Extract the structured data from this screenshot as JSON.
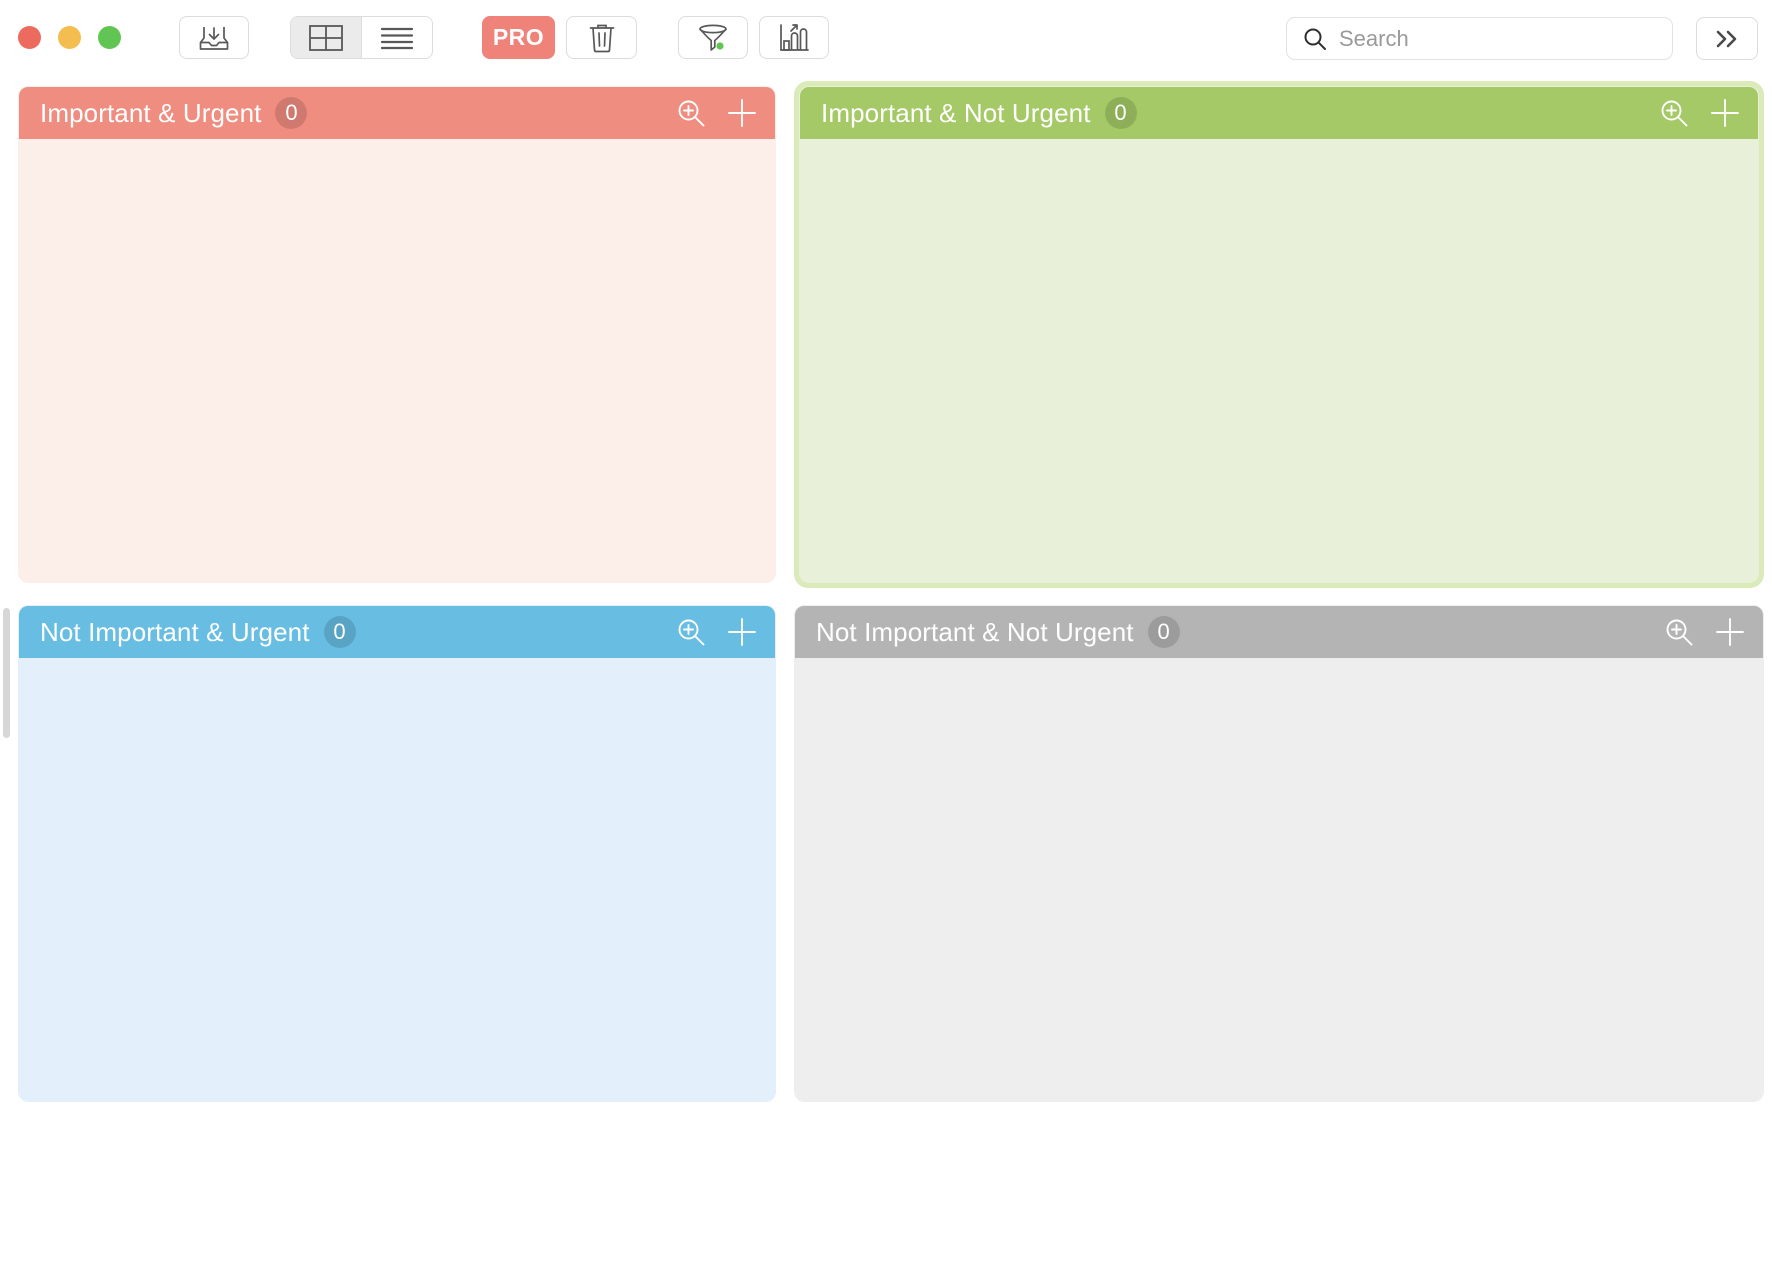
{
  "window": {
    "traffic_lights": [
      {
        "name": "close",
        "color": "#ed6a5e"
      },
      {
        "name": "minimize",
        "color": "#f4bd4f"
      },
      {
        "name": "maximize",
        "color": "#61c554"
      }
    ]
  },
  "toolbar": {
    "inbox_label": "inbox-icon",
    "view_grid_label": "grid-view-icon",
    "view_list_label": "list-view-icon",
    "view_selected": "grid",
    "pro_label": "PRO",
    "pro_color": "#ef8279",
    "trash_label": "trash-icon",
    "filter_label": "filter-icon",
    "filter_badge_color": "#5ec84e",
    "chart_label": "chart-icon",
    "chevron_label": "chevron-double-right-icon"
  },
  "search": {
    "value": "",
    "placeholder": "Search"
  },
  "quadrants": [
    {
      "id": "important-urgent",
      "title": "Important & Urgent",
      "count": "0",
      "header_color": "#ef8d80",
      "body_color": "#fceee9",
      "selected": false,
      "zoom_icon": "zoom-in-icon",
      "add_icon": "plus-icon"
    },
    {
      "id": "important-not-urgent",
      "title": "Important & Not Urgent",
      "count": "0",
      "header_color": "#a4c966",
      "body_color": "#e9f0da",
      "selected": true,
      "selection_color": "#daeab8",
      "zoom_icon": "zoom-in-icon",
      "add_icon": "plus-icon"
    },
    {
      "id": "not-important-urgent",
      "title": "Not Important & Urgent",
      "count": "0",
      "header_color": "#67bde2",
      "body_color": "#e3f0fc",
      "selected": false,
      "zoom_icon": "zoom-in-icon",
      "add_icon": "plus-icon"
    },
    {
      "id": "not-important-not-urgent",
      "title": "Not Important & Not Urgent",
      "count": "0",
      "header_color": "#b4b4b4",
      "body_color": "#eeeeee",
      "selected": false,
      "zoom_icon": "zoom-in-icon",
      "add_icon": "plus-icon"
    }
  ]
}
